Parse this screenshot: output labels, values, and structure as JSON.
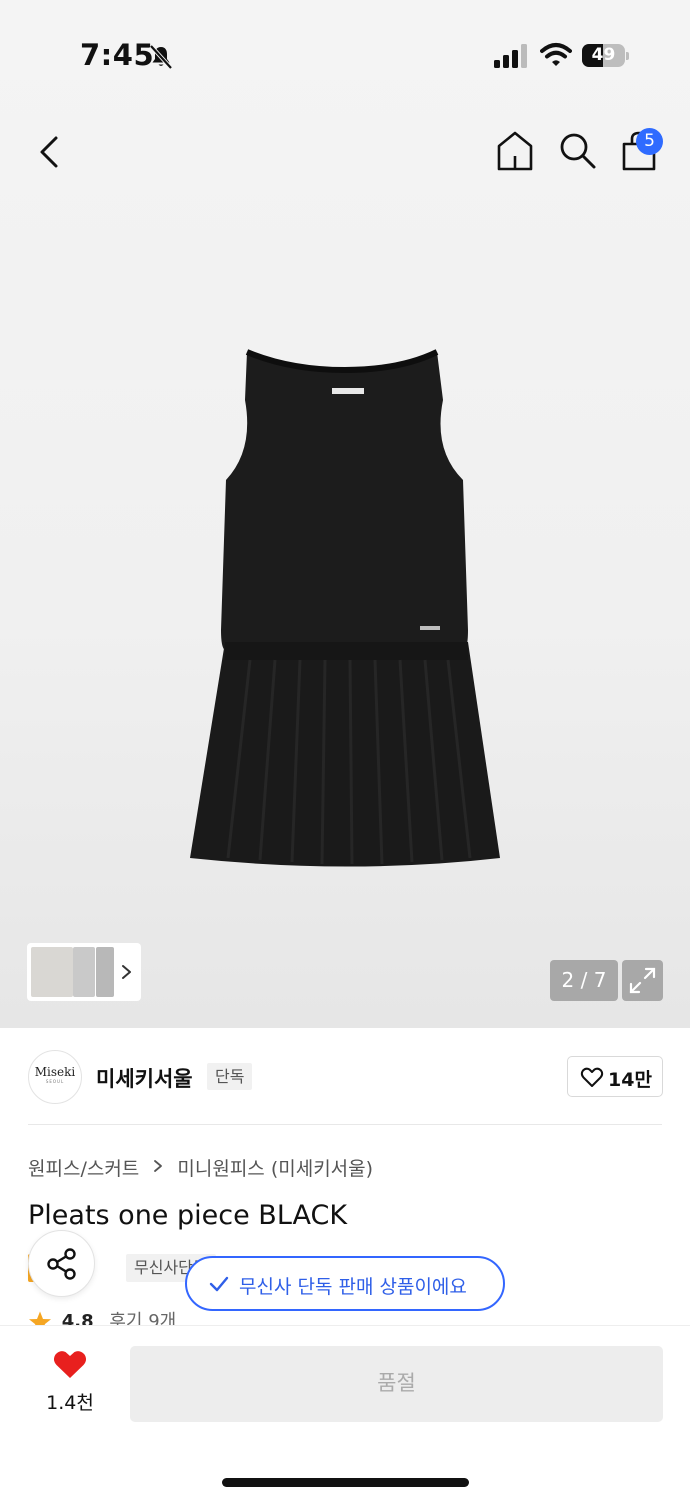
{
  "status_bar": {
    "time": "7:45",
    "battery": "49",
    "battery_level": 0.49
  },
  "nav": {
    "cart_count": "5"
  },
  "gallery": {
    "page_counter": "2 / 7"
  },
  "brand": {
    "logo_text": "Miseki",
    "logo_sub": "SEOUL",
    "name": "미세키서울",
    "exclusive_tag": "단독",
    "like_count": "14만"
  },
  "breadcrumb": {
    "category": "원피스/스커트",
    "subcategory": "미니원피스 (미세키서울)"
  },
  "product": {
    "title": "Pleats one piece BLACK",
    "sale_tag": "세일",
    "musinsa_tag": "무신사단독",
    "rating": "4.8",
    "reviews": "후기 9개"
  },
  "toast": {
    "message": "무신사 단독 판매 상품이에요"
  },
  "bottom_bar": {
    "wish_count": "1.4천",
    "soldout_label": "품절"
  },
  "colors": {
    "accent_blue": "#2f6bff",
    "heart_red": "#e8201e",
    "sale_orange": "#f5a623",
    "star_orange": "#f5a623"
  }
}
